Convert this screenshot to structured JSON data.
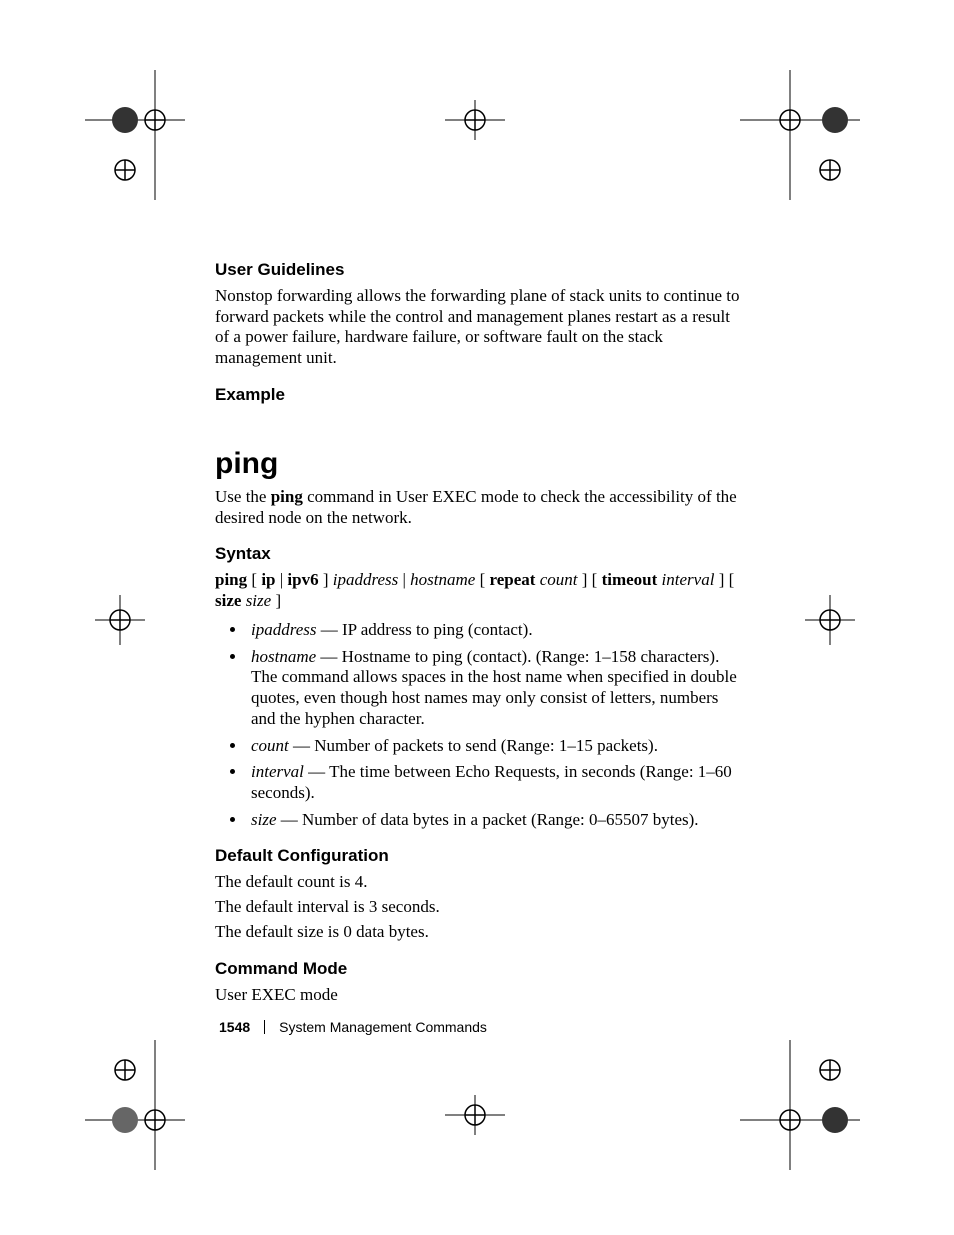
{
  "sections": {
    "user_guidelines": {
      "heading": "User Guidelines",
      "body": "Nonstop forwarding allows the forwarding plane of stack units to continue to forward packets while the control and management planes restart as a result of a power failure, hardware failure, or software fault on the stack management unit."
    },
    "example": {
      "heading": "Example"
    },
    "command": {
      "title": "ping",
      "intro_pre": "Use the ",
      "intro_bold": "ping",
      "intro_post": " command in User EXEC mode to check the accessibility of the desired node on the network."
    },
    "syntax": {
      "heading": "Syntax",
      "line": {
        "p1": "ping",
        "p2": " [ ",
        "p3": "ip",
        "p4": " | ",
        "p5": "ipv6",
        "p6": " ] ",
        "p7": "ipaddress",
        "p8": " | ",
        "p9": "hostname",
        "p10": " [ ",
        "p11": "repeat",
        "p12": " ",
        "p13": "count",
        "p14": " ] [ ",
        "p15": "timeout",
        "p16": " ",
        "p17": "interval",
        "p18": " ] [ ",
        "p19": "size",
        "p20": " ",
        "p21": "size",
        "p22": " ]"
      },
      "items": [
        {
          "term": "ipaddress",
          "desc": " — IP address to ping (contact)."
        },
        {
          "term": "hostname",
          "desc": " — Hostname to ping (contact). (Range: 1–158 characters). The command allows spaces in the host name when specified in double quotes, even though host names may only consist of letters, numbers and the hyphen character."
        },
        {
          "term": "count",
          "desc": " — Number of packets to send (Range: 1–15 packets)."
        },
        {
          "term": "interval",
          "desc": " — The time between Echo Requests, in seconds (Range: 1–60 seconds)."
        },
        {
          "term": "size",
          "desc": " — Number of data bytes in a packet (Range: 0–65507 bytes)."
        }
      ]
    },
    "default_cfg": {
      "heading": "Default Configuration",
      "lines": [
        "The default count is 4.",
        "The default interval is 3 seconds.",
        "The default size is 0 data bytes."
      ]
    },
    "command_mode": {
      "heading": "Command Mode",
      "body": "User EXEC mode"
    }
  },
  "footer": {
    "page_number": "1548",
    "chapter": "System Management Commands"
  }
}
